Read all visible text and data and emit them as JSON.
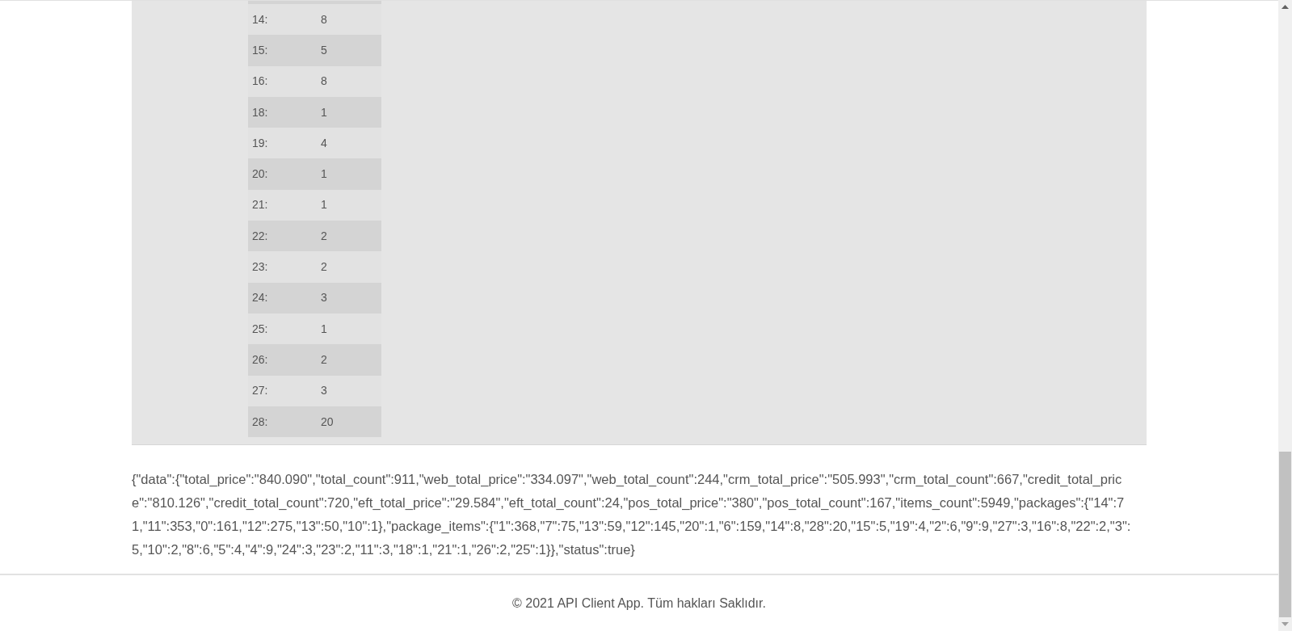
{
  "package_items_table": {
    "rows": [
      {
        "key": "14:",
        "value": "8"
      },
      {
        "key": "15:",
        "value": "5"
      },
      {
        "key": "16:",
        "value": "8"
      },
      {
        "key": "18:",
        "value": "1"
      },
      {
        "key": "19:",
        "value": "4"
      },
      {
        "key": "20:",
        "value": "1"
      },
      {
        "key": "21:",
        "value": "1"
      },
      {
        "key": "22:",
        "value": "2"
      },
      {
        "key": "23:",
        "value": "2"
      },
      {
        "key": "24:",
        "value": "3"
      },
      {
        "key": "25:",
        "value": "1"
      },
      {
        "key": "26:",
        "value": "2"
      },
      {
        "key": "27:",
        "value": "3"
      },
      {
        "key": "28:",
        "value": "20"
      }
    ]
  },
  "raw_response": "{\"data\":{\"total_price\":\"840.090\",\"total_count\":911,\"web_total_price\":\"334.097\",\"web_total_count\":244,\"crm_total_price\":\"505.993\",\"crm_total_count\":667,\"credit_total_price\":\"810.126\",\"credit_total_count\":720,\"eft_total_price\":\"29.584\",\"eft_total_count\":24,\"pos_total_price\":\"380\",\"pos_total_count\":167,\"items_count\":5949,\"packages\":{\"14\":71,\"11\":353,\"0\":161,\"12\":275,\"13\":50,\"10\":1},\"package_items\":{\"1\":368,\"7\":75,\"13\":59,\"12\":145,\"20\":1,\"6\":159,\"14\":8,\"28\":20,\"15\":5,\"19\":4,\"2\":6,\"9\":9,\"27\":3,\"16\":8,\"22\":2,\"3\":5,\"10\":2,\"8\":6,\"5\":4,\"4\":9,\"24\":3,\"23\":2,\"11\":3,\"18\":1,\"21\":1,\"26\":2,\"25\":1}},\"status\":true}",
  "footer": {
    "copyright": "© 2021 API Client App. Tüm hakları Saklıdır."
  }
}
